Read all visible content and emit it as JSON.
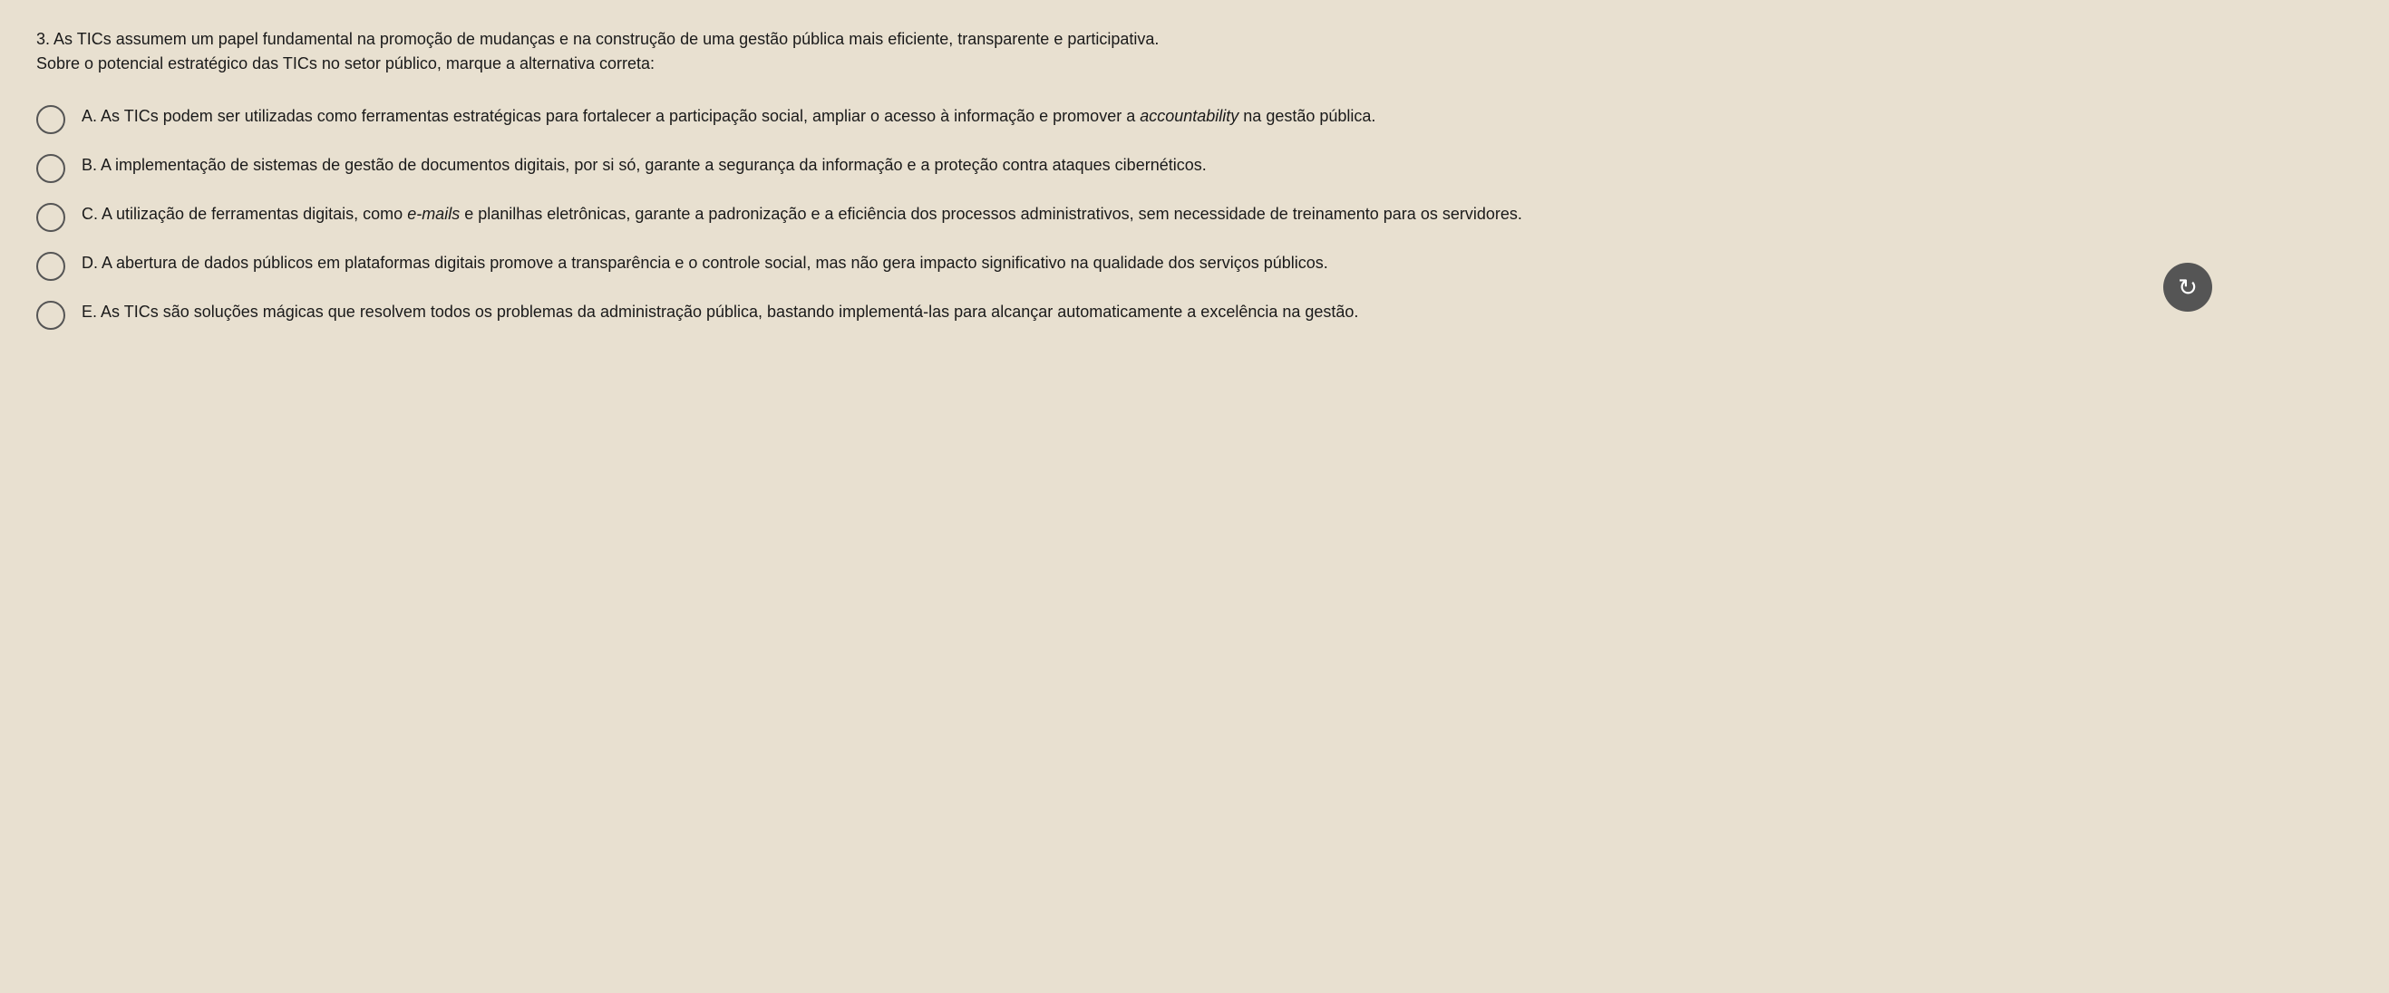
{
  "question": {
    "number": "3.",
    "intro_line1": "As TICs assumem um papel fundamental na promoção de mudanças e na construção de uma gestão pública mais eficiente, transparente e participativa.",
    "intro_line2": "Sobre o potencial estratégico das TICs no setor público, marque a alternativa correta:",
    "options": [
      {
        "id": "A",
        "label": "A.",
        "text_part1": "As TICs podem ser utilizadas como ferramentas estratégicas para fortalecer a participação social, ampliar o acesso à informação e promover a ",
        "text_italic": "accountability",
        "text_part2": " na gestão pública."
      },
      {
        "id": "B",
        "label": "B.",
        "text_part1": "A implementação de sistemas de gestão de documentos digitais, por si só, garante a segurança da informação e a proteção contra ataques cibernéticos.",
        "text_italic": "",
        "text_part2": ""
      },
      {
        "id": "C",
        "label": "C.",
        "text_part1": "A utilização de ferramentas digitais, como ",
        "text_italic": "e-mails",
        "text_part2": " e planilhas eletrônicas, garante a padronização e a eficiência dos processos administrativos, sem necessidade de treinamento para os servidores."
      },
      {
        "id": "D",
        "label": "D.",
        "text_part1": "A abertura de dados públicos em plataformas digitais promove a transparência e o controle social, mas não gera impacto significativo na qualidade dos serviços públicos.",
        "text_italic": "",
        "text_part2": ""
      },
      {
        "id": "E",
        "label": "E.",
        "text_part1": "As TICs são soluções mágicas que resolvem todos os problemas da administração pública, bastando implementá-las para alcançar automaticamente a excelência na gestão.",
        "text_italic": "",
        "text_part2": ""
      }
    ]
  }
}
